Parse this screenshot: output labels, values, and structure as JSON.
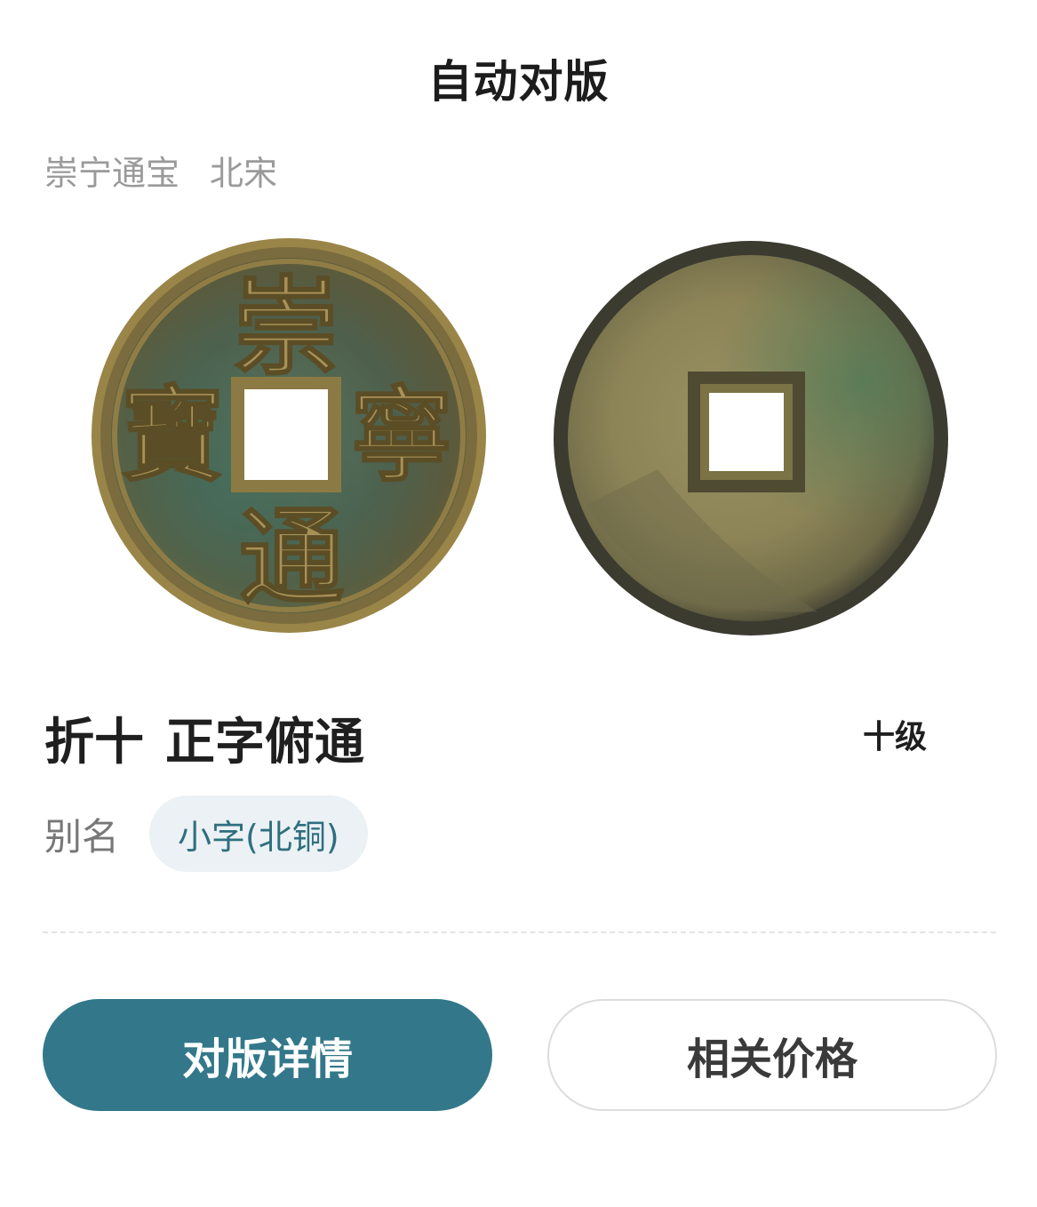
{
  "header": {
    "title": "自动对版"
  },
  "coin": {
    "name": "崇宁通宝",
    "dynasty": "北宋",
    "face_characters": [
      "崇",
      "寧",
      "通",
      "寶"
    ],
    "variant_prefix": "折十",
    "variant_name": "正字俯通",
    "grade": "十级",
    "alias_label": "别名",
    "alias_value": "小字(北铜)"
  },
  "actions": {
    "detail_label": "对版详情",
    "price_label": "相关价格"
  },
  "colors": {
    "primary": "#33788a",
    "chip_bg": "#ebf1f4",
    "chip_text": "#2f6f7f",
    "muted_text": "#9a9a9a"
  }
}
